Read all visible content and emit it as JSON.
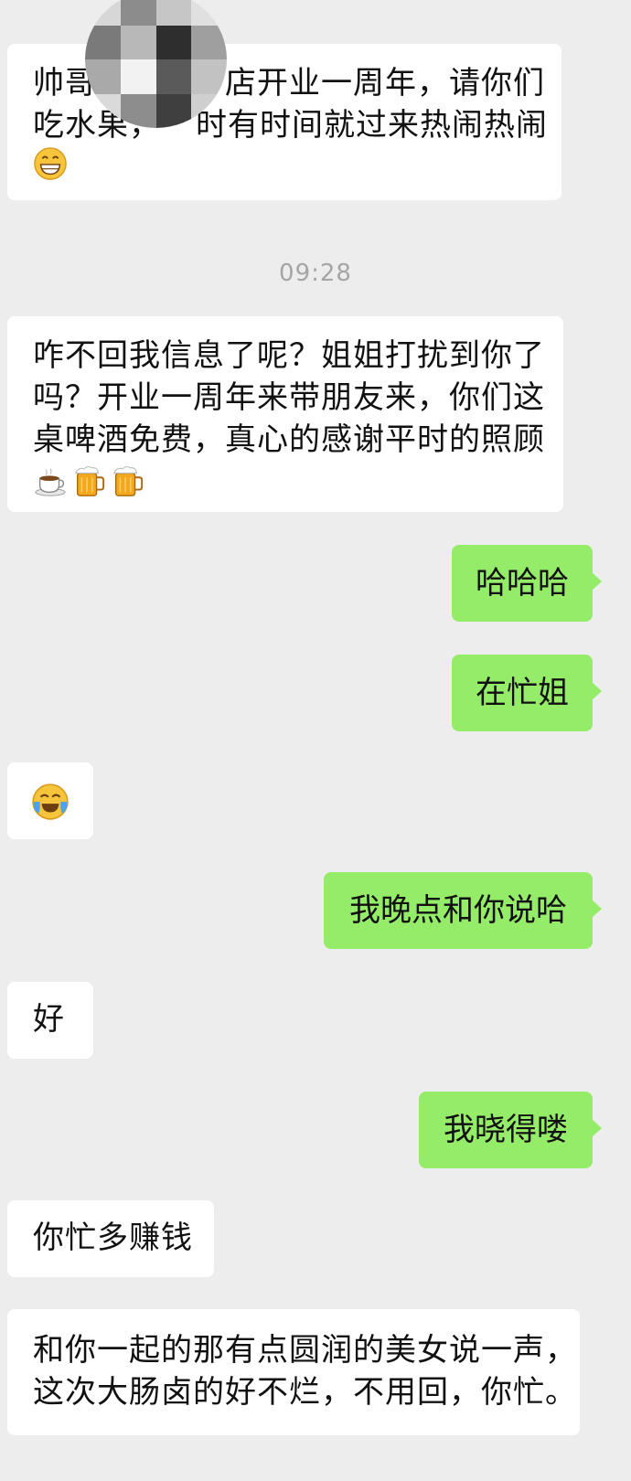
{
  "timestamp": "09:28",
  "messages": [
    {
      "side": "incoming",
      "lines": [
        "帅哥",
        "吃水果，",
        "时有时间就过来热闹热闹"
      ],
      "emoji": [
        "grin-face-icon"
      ]
    },
    {
      "side": "incoming",
      "lines": [
        "咋不回我信息了呢？姐姐打扰到你了",
        "吗？开业一周年来带朋友来，你们这",
        "桌啤酒免费，真心的感谢平时的照顾"
      ],
      "emoji": [
        "coffee-cup-icon",
        "beer-mug-icon",
        "beer-mug-icon"
      ]
    },
    {
      "side": "outgoing",
      "text": "哈哈哈"
    },
    {
      "side": "outgoing",
      "text": "在忙姐"
    },
    {
      "side": "incoming",
      "emoji": [
        "laugh-cry-face-icon"
      ]
    },
    {
      "side": "outgoing",
      "text": "我晚点和你说哈"
    },
    {
      "side": "incoming",
      "text": "好"
    },
    {
      "side": "outgoing",
      "text": "我晓得喽"
    },
    {
      "side": "incoming",
      "text": "你忙多赚钱"
    },
    {
      "side": "incoming",
      "lines": [
        "和你一起的那有点圆润的美女说一声，",
        "这次大肠卤的好不烂，不用回，你忙。"
      ]
    }
  ],
  "first_line_rest": "店开业一周年，请你们",
  "colors": {
    "background": "#ededed",
    "incoming_bubble": "#ffffff",
    "outgoing_bubble": "#95ec69",
    "timestamp": "#a5a5a5"
  }
}
